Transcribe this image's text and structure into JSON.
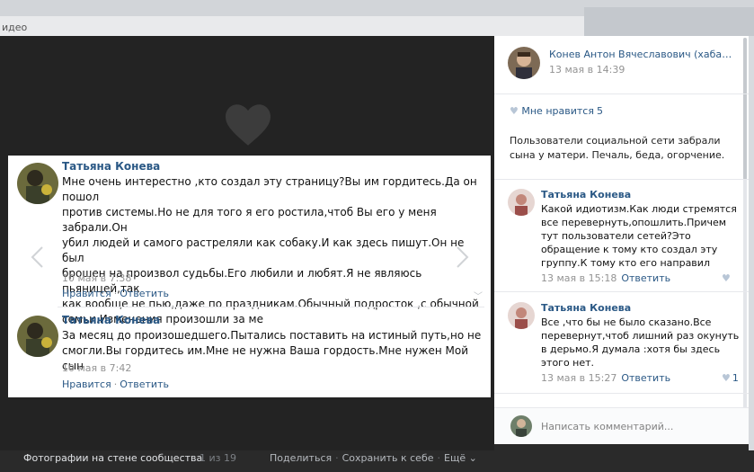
{
  "top": {
    "crumb": "идео"
  },
  "post_photo": {
    "posts": [
      {
        "author": "Татьяна Конева",
        "lines": [
          "Мне очень интерестно ,кто создал эту страницу?Вы им гордитесь.Да он пошол",
          "против системы.Но не для того я его ростила,чтоб Вы его у меня забрали.Он",
          "убил людей и самого растреляли как собаку.И как здесь пишут.Он не был",
          "брошен на произвол судьбы.Его любили и любят.Я не являюсь пьяницей,так",
          "как вообще не пью,даже по праздникам.Обычный подросток ,с обычной",
          "семьи.Изменения произошли за ме"
        ],
        "time": "10 мая в 7:38",
        "like": "Нравится",
        "reply": "Ответить"
      },
      {
        "author": "Татьяна Конева",
        "lines": [
          "За месяц до произошедшего.Пытались поставить на истиный путь,но не",
          "смогли.Вы гордитесь им.Мне не нужна Ваша гордость.Мне нужен Мой сын"
        ],
        "time": "10 мая в 7:42",
        "like": "Нравится",
        "reply": "Ответить"
      }
    ]
  },
  "footer": {
    "title": "Фотографии на стене сообщества",
    "count": "1 из 19",
    "share": "Поделиться",
    "save": "Сохранить к себе",
    "more": "Ещё ⌄"
  },
  "panel": {
    "owner_name": "Конев Антон Вячеславович (хабаровск)",
    "date": "13 мая в 14:39",
    "likes_label": "Мне нравится",
    "likes_count": "5",
    "description": "Пользователи социальной сети забрали сына у матери. Печаль, беда, огорчение.",
    "comments": [
      {
        "author": "Татьяна Конева",
        "text": "Какой идиотизм.Как люди стремятся все перевернуть,опошлить.Причем тут пользователи сетей?Это обращение к тому кто создал эту группу.К тому кто его направил",
        "date": "13 мая в 15:18",
        "reply": "Ответить",
        "likes": ""
      },
      {
        "author": "Татьяна Конева",
        "text": "Все ,что бы не было сказано.Все перевернут,чтоб лишний раз окунуть в дерьмо.Я думала :хотя бы здесь этого нет.",
        "date": "13 мая в 15:27",
        "reply": "Ответить",
        "likes": "1"
      }
    ],
    "comment_placeholder": "Написать комментарий..."
  },
  "colors": {
    "link": "#2a5885",
    "muted": "#939393",
    "viewer_bg": "#232323"
  }
}
